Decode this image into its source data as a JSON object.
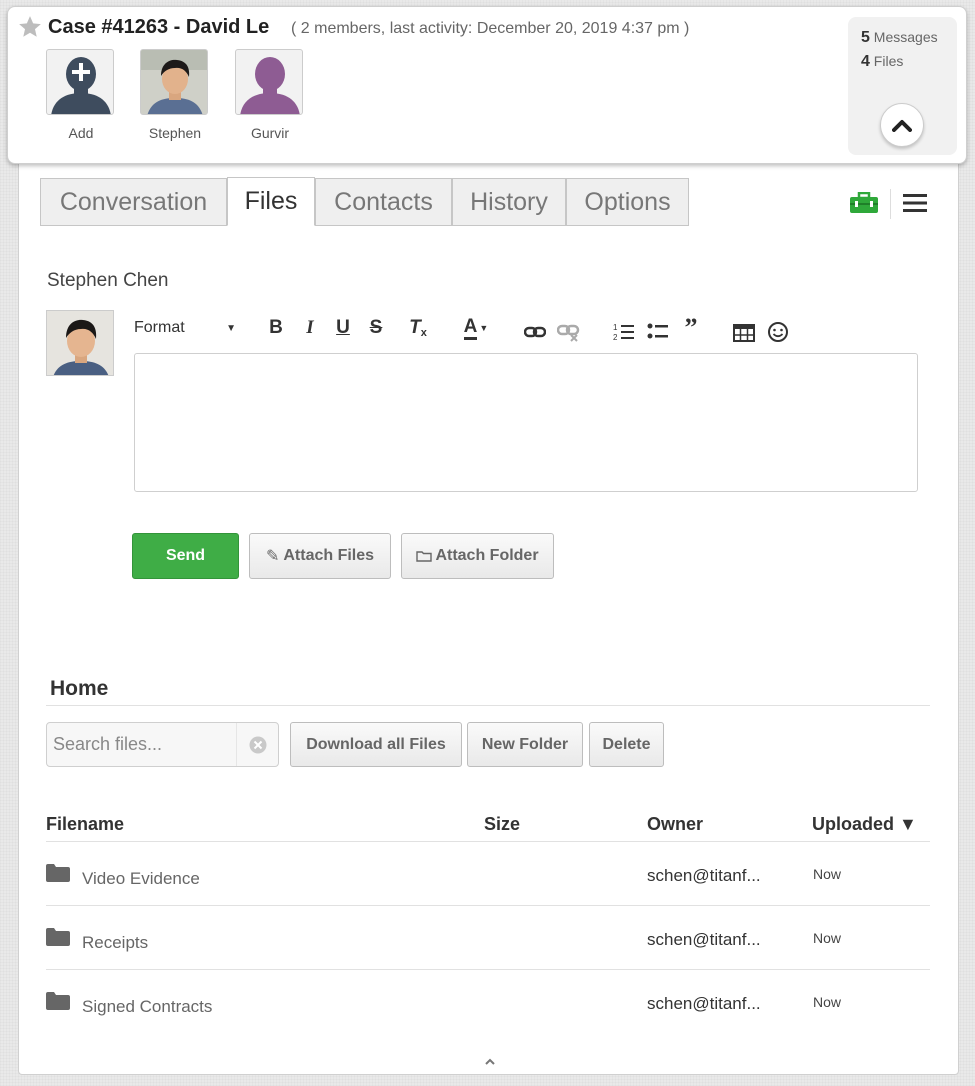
{
  "header": {
    "case_title": "Case #41263 - David Le",
    "case_meta": "( 2 members, last activity: December 20, 2019 4:37 pm )",
    "members": [
      {
        "name": "Add"
      },
      {
        "name": "Stephen"
      },
      {
        "name": "Gurvir"
      }
    ],
    "stats": {
      "messages_count": "5",
      "messages_label": "Messages",
      "files_count": "4",
      "files_label": "Files"
    }
  },
  "tabs": [
    {
      "label": "Conversation",
      "active": false
    },
    {
      "label": "Files",
      "active": true
    },
    {
      "label": "Contacts",
      "active": false
    },
    {
      "label": "History",
      "active": false
    },
    {
      "label": "Options",
      "active": false
    }
  ],
  "composer": {
    "author_name": "Stephen Chen",
    "format_label": "Format",
    "send_label": "Send",
    "attach_files_label": "Attach Files",
    "attach_folder_label": "Attach Folder"
  },
  "files": {
    "section_title": "Home",
    "search_placeholder": "Search files...",
    "download_all_label": "Download all Files",
    "new_folder_label": "New Folder",
    "delete_label": "Delete",
    "columns": {
      "filename": "Filename",
      "size": "Size",
      "owner": "Owner",
      "uploaded": "Uploaded ▼"
    },
    "rows": [
      {
        "name": "Video Evidence",
        "size": "",
        "owner": "schen@titanf...",
        "uploaded": "Now"
      },
      {
        "name": "Receipts",
        "size": "",
        "owner": "schen@titanf...",
        "uploaded": "Now"
      },
      {
        "name": "Signed Contracts",
        "size": "",
        "owner": "schen@titanf...",
        "uploaded": "Now"
      }
    ]
  },
  "icons": {
    "star": "star-icon",
    "collapse": "chevron-up-icon",
    "briefcase": "briefcase-icon",
    "menu": "hamburger-menu-icon",
    "folder": "folder-icon"
  },
  "colors": {
    "send_green": "#3fad46",
    "briefcase_green": "#2fa83a",
    "gurvir_purple": "#8e5c93",
    "add_navy": "#3e4c5e"
  }
}
